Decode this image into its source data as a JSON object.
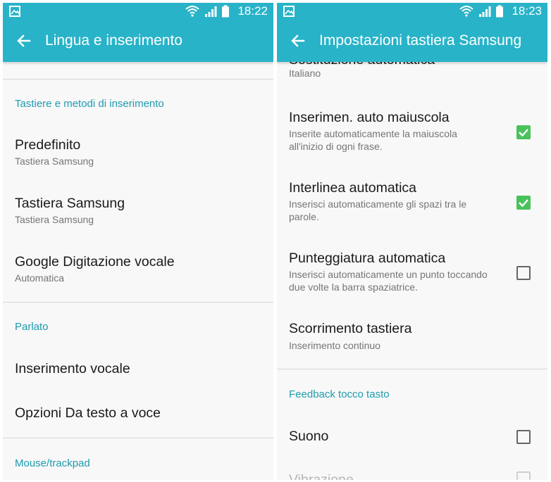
{
  "colors": {
    "accent": "#28b3c8",
    "section_header": "#1f9bae",
    "checkbox_on": "#4ac25c"
  },
  "left": {
    "status": {
      "time": "18:22",
      "icons": [
        "gallery-notification-icon",
        "wifi-icon",
        "signal-icon",
        "battery-icon"
      ]
    },
    "appbar": {
      "title": "Lingua e inserimento"
    },
    "sections": [
      {
        "header": "Tastiere e metodi di inserimento",
        "items": [
          {
            "title": "Predefinito",
            "subtitle": "Tastiera Samsung"
          },
          {
            "title": "Tastiera Samsung",
            "subtitle": "Tastiera Samsung"
          },
          {
            "title": "Google Digitazione vocale",
            "subtitle": "Automatica"
          }
        ]
      },
      {
        "header": "Parlato",
        "items": [
          {
            "title": "Inserimento vocale"
          },
          {
            "title": "Opzioni Da testo a voce"
          }
        ]
      },
      {
        "header": "Mouse/trackpad",
        "items": []
      }
    ]
  },
  "right": {
    "status": {
      "time": "18:23",
      "icons": [
        "gallery-notification-icon",
        "wifi-icon",
        "signal-icon",
        "battery-icon"
      ]
    },
    "appbar": {
      "title": "Impostazioni tastiera Samsung"
    },
    "partial_top_item": {
      "title": "Sostituzione automatica",
      "subtitle": "Italiano"
    },
    "items": [
      {
        "title": "Inserimen. auto maiuscola",
        "subtitle_lines": [
          "Inserite automaticamente la maiuscola",
          "all'inizio di ogni frase."
        ],
        "checked": true
      },
      {
        "title": "Interlinea automatica",
        "subtitle_lines": [
          "Inserisci automaticamente gli spazi tra le",
          "parole."
        ],
        "checked": true
      },
      {
        "title": "Punteggiatura automatica",
        "subtitle_lines": [
          "Inserisci automaticamente un punto toccando",
          "due volte la barra spaziatrice."
        ],
        "checked": false
      },
      {
        "title": "Scorrimento tastiera",
        "subtitle": "Inserimento continuo"
      }
    ],
    "feedback_section": {
      "header": "Feedback tocco tasto",
      "items": [
        {
          "title": "Suono",
          "checked": false
        },
        {
          "title": "Vibrazione",
          "checked": false
        }
      ]
    }
  }
}
